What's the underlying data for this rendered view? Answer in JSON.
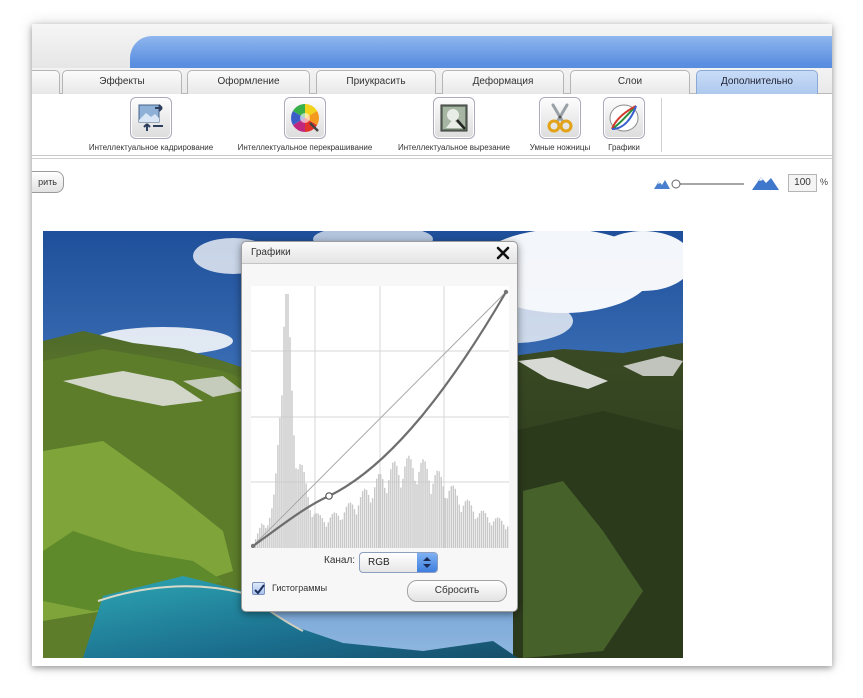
{
  "tabs": [
    {
      "label": ""
    },
    {
      "label": "Эффекты"
    },
    {
      "label": "Оформление"
    },
    {
      "label": "Приукрасить"
    },
    {
      "label": "Деформация"
    },
    {
      "label": "Слои"
    },
    {
      "label": "Дополнительно",
      "active": true
    }
  ],
  "tools": [
    {
      "label": "Интеллектуальное кадрирование",
      "icon": "smart-crop-icon"
    },
    {
      "label": "Интеллектуальное перекрашивание",
      "icon": "color-wheel-icon"
    },
    {
      "label": "Интеллектуальное вырезание",
      "icon": "smart-cutout-icon"
    },
    {
      "label": "Умные ножницы",
      "icon": "scissors-icon"
    },
    {
      "label": "Графики",
      "icon": "curves-icon"
    }
  ],
  "toolbar": {
    "apply_label": "рить"
  },
  "zoom": {
    "value": "100",
    "unit": "%",
    "slider_position": 0.0
  },
  "dialog": {
    "title": "Графики",
    "channel_label": "Канал:",
    "channel_value": "RGB",
    "histogram_label": "Гистограммы",
    "histogram_checked": true,
    "reset_label": "Сбросить"
  },
  "colors": {
    "accent_blue": "#4f84d8",
    "active_tab": "#aec9ee",
    "histogram": "#c8c8c8",
    "curve": "#6e6e6e"
  }
}
